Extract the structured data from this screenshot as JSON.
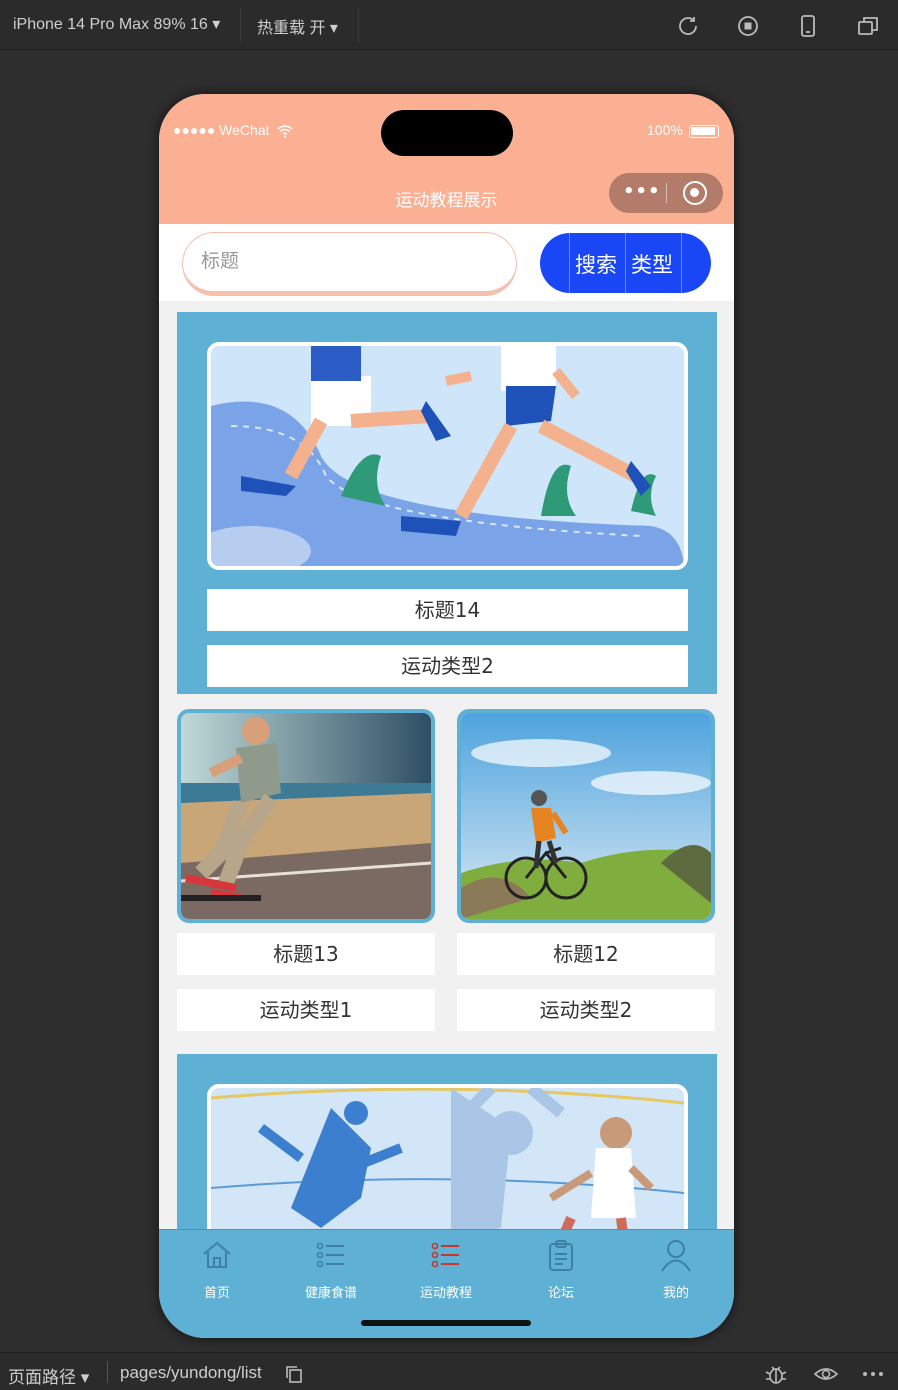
{
  "devtools": {
    "device_label": "iPhone 14 Pro Max 89% 16 ▾",
    "hot_reload_label": "热重载 开 ▾",
    "path_label": "页面路径 ▾",
    "path_value": "pages/yundong/list"
  },
  "status": {
    "carrier": "●●●●● WeChat",
    "battery": "100%"
  },
  "nav": {
    "title": "运动教程展示",
    "capsule_dots": "•••"
  },
  "search": {
    "placeholder": "标题",
    "buttons": [
      "搜索",
      "类型"
    ]
  },
  "items": [
    {
      "title": "标题14",
      "type": "运动类型2"
    },
    {
      "title": "标题13",
      "type": "运动类型1"
    },
    {
      "title": "标题12",
      "type": "运动类型2"
    }
  ],
  "tabbar": [
    {
      "label": "首页",
      "icon": "home-icon"
    },
    {
      "label": "健康食谱",
      "icon": "list-icon"
    },
    {
      "label": "运动教程",
      "icon": "list-active-icon"
    },
    {
      "label": "论坛",
      "icon": "clipboard-icon"
    },
    {
      "label": "我的",
      "icon": "user-icon"
    }
  ],
  "colors": {
    "header": "#fbb094",
    "accent_blue": "#1a47f5",
    "card_blue": "#5fb0d5",
    "active_tab": "#c0392b"
  }
}
